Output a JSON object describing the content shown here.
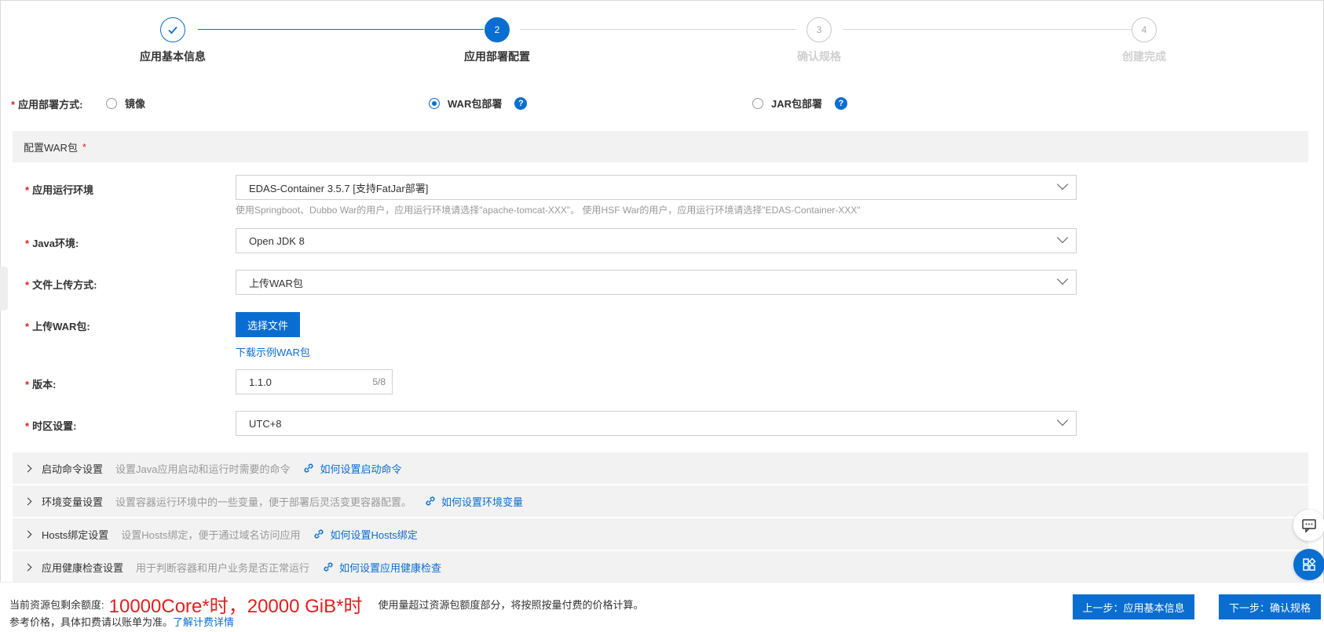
{
  "steps": [
    {
      "number": "",
      "label": "应用基本信息",
      "state": "done"
    },
    {
      "number": "2",
      "label": "应用部署配置",
      "state": "active"
    },
    {
      "number": "3",
      "label": "确认规格",
      "state": "pending"
    },
    {
      "number": "4",
      "label": "创建完成",
      "state": "pending"
    }
  ],
  "deploy_method": {
    "required": "*",
    "label": "应用部署方式:",
    "options": [
      {
        "label": "镜像",
        "checked": false
      },
      {
        "label": "WAR包部署",
        "checked": true
      },
      {
        "label": "JAR包部署",
        "checked": false
      }
    ],
    "help": "?"
  },
  "war_section": {
    "title": "配置WAR包",
    "required": "*"
  },
  "form": {
    "runtime": {
      "label": "应用运行环境",
      "value": "EDAS-Container 3.5.7 [支持FatJar部署]",
      "hint": "使用Springboot、Dubbo War的用户，应用运行环境请选择\"apache-tomcat-XXX\"。 使用HSF War的用户，应用运行环境请选择\"EDAS-Container-XXX\""
    },
    "java": {
      "label": "Java环境:",
      "value": "Open JDK 8"
    },
    "upload_method": {
      "label": "文件上传方式:",
      "value": "上传WAR包"
    },
    "upload_war": {
      "label": "上传WAR包:",
      "button": "选择文件",
      "sample_link": "下载示例WAR包"
    },
    "version": {
      "label": "版本:",
      "value": "1.1.0",
      "counter": "5/8"
    },
    "timezone": {
      "label": "时区设置:",
      "value": "UTC+8"
    }
  },
  "collapses": [
    {
      "title": "启动命令设置",
      "desc": "设置Java应用启动和运行时需要的命令",
      "link": "如何设置启动命令"
    },
    {
      "title": "环境变量设置",
      "desc": "设置容器运行环境中的一些变量，便于部署后灵活变更容器配置。",
      "link": "如何设置环境变量"
    },
    {
      "title": "Hosts绑定设置",
      "desc": "设置Hosts绑定，便于通过域名访问应用",
      "link": "如何设置Hosts绑定"
    },
    {
      "title": "应用健康检查设置",
      "desc": "用于判断容器和用户业务是否正常运行",
      "link": "如何设置应用健康检查"
    }
  ],
  "footer": {
    "quota_label": "当前资源包剩余额度:",
    "quota_value": "10000Core*时，20000 GiB*时",
    "quota_note": "使用量超过资源包额度部分，将按照按量付费的价格计算。",
    "ref_text": "参考价格，具体扣费请以账单为准。",
    "ref_link": "了解计费详情",
    "prev_button": "上一步：应用基本信息",
    "next_button": "下一步：确认规格"
  },
  "colors": {
    "primary": "#0a6ed1",
    "required": "#e02020",
    "muted": "#999999"
  }
}
